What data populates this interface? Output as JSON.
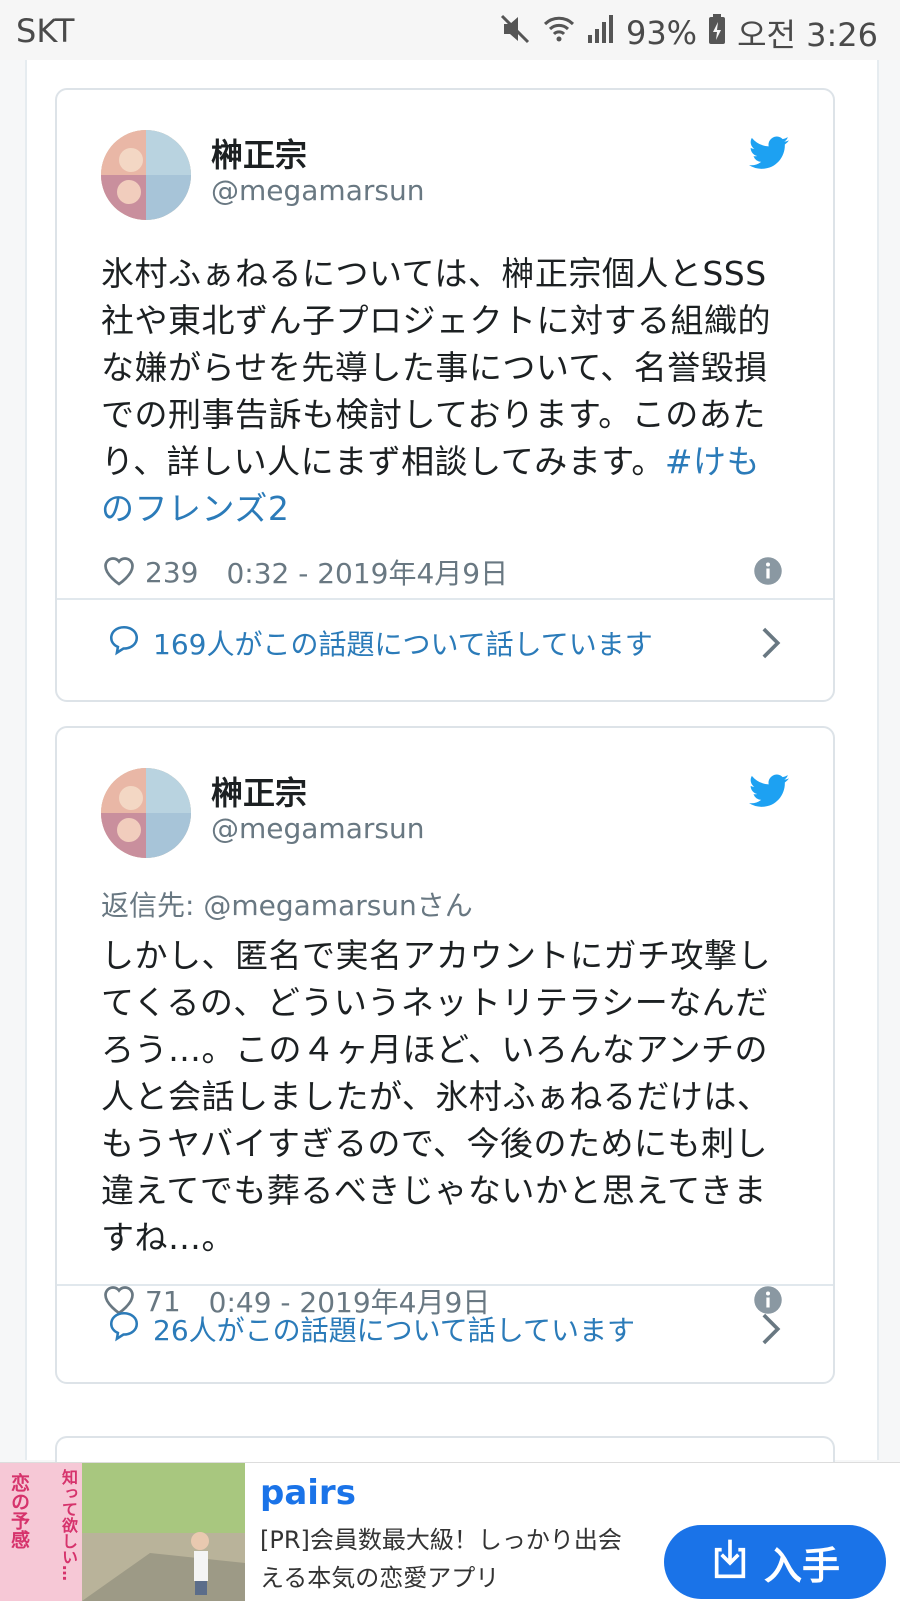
{
  "status_bar": {
    "carrier": "SKT",
    "battery": "93%",
    "time": "오전 3:26"
  },
  "tweets": [
    {
      "name": "榊正宗",
      "handle": "@megamarsun",
      "reply_to": "",
      "text": "氷村ふぁねるについては、榊正宗個人とSSS社や東北ずん子プロジェクトに対する組織的な嫌がらせを先導した事について、名誉毀損での刑事告訴も検討しております。このあたり、詳しい人にまず相談してみます。",
      "hashtag": "#けものフレンズ2",
      "likes": "239",
      "timestamp": "0:32 - 2019年4月9日",
      "replies_label": "169人がこの話題について話しています"
    },
    {
      "name": "榊正宗",
      "handle": "@megamarsun",
      "reply_to": "返信先: @megamarsunさん",
      "text": "しかし、匿名で実名アカウントにガチ攻撃してくるの、どういうネットリテラシーなんだろう…。この４ヶ月ほど、いろんなアンチの人と会話しましたが、氷村ふぁねるだけは、もうヤバイすぎるので、今後のためにも刺し違えてでも葬るべきじゃないかと思えてきますね…。",
      "hashtag": "",
      "likes": "71",
      "timestamp": "0:49 - 2019年4月9日",
      "replies_label": "26人がこの話題について話しています"
    }
  ],
  "ad": {
    "brand": "pairs",
    "description": "[PR]会員数最大級！しっかり出会える本気の恋愛アプリ",
    "button_label": "入手",
    "image_text": "恋の予感",
    "image_text_2": "知って欲しい…"
  },
  "colors": {
    "link": "#2b7bb9",
    "twitter_blue": "#1da1f2",
    "ad_button": "#1a73e8"
  },
  "icons": [
    "mute-icon",
    "wifi-icon",
    "signal-icon",
    "battery-icon",
    "twitter-bird-icon",
    "heart-icon",
    "info-icon",
    "comment-icon",
    "chevron-right-icon",
    "download-icon"
  ]
}
